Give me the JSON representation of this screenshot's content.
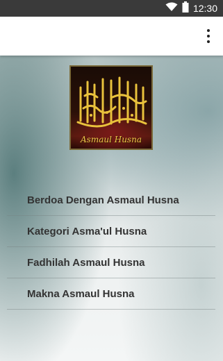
{
  "status_bar": {
    "time": "12:30",
    "icons": [
      "wifi-icon",
      "battery-icon"
    ],
    "background": "#3a3a3a"
  },
  "app_bar": {
    "menu_icon": "overflow-menu-icon"
  },
  "logo": {
    "caption": "Asmaul Husna",
    "accent": "#e8c24a"
  },
  "menu": {
    "items": [
      {
        "label": "Berdoa Dengan Asmaul Husna"
      },
      {
        "label": "Kategori Asma'ul Husna"
      },
      {
        "label": "Fadhilah Asmaul Husna"
      },
      {
        "label": "Makna Asmaul Husna"
      }
    ]
  }
}
